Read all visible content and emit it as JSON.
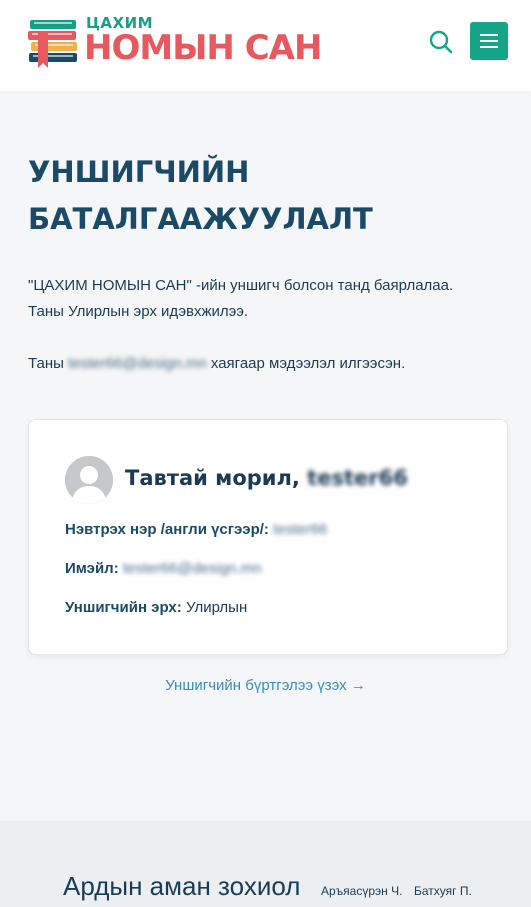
{
  "header": {
    "logo_small": "ЦАХИМ",
    "logo_big": "НОМЫН САН",
    "icons": [
      "books-logo-icon",
      "search-icon",
      "hamburger-menu-icon"
    ]
  },
  "main": {
    "title": "УНШИГЧИЙН БАТАЛГААЖУУЛАЛТ",
    "thanks_line": "\"ЦАХИМ НОМЫН САН\" -ийн уншигч болсон танд баярлалаа.",
    "rights_line": "Таны Улирлын эрх идэвхжилээ.",
    "sent_prefix": "Таны ",
    "sent_email": "tester66@design.mn",
    "sent_suffix": " хаягаар мэдээлэл илгээсэн."
  },
  "card": {
    "welcome": "Тавтай морил,",
    "username": "tester66",
    "login_label": "Нэвтрэх нэр /англи үсгээр/:",
    "login_value": "tester66",
    "email_label": "Имэйл:",
    "email_value": "tester66@design.mn",
    "rights_label": "Уншигчийн эрх:",
    "rights_value": "Улирлын"
  },
  "link": {
    "view_registration": "Уншигчийн бүртгэлээ үзэх →"
  },
  "footer": {
    "book_title": "Ардын аман зохиол",
    "authors": [
      "Аръяасүрэн Ч.",
      "Батхуяг П."
    ]
  },
  "colors": {
    "accent": "#17a589",
    "brand_red": "#e8585f",
    "heading": "#1b4a67",
    "link": "#3a8fb7"
  }
}
